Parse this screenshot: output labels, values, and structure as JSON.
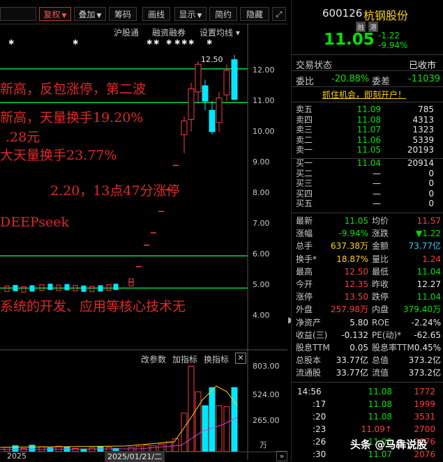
{
  "toolbar": {
    "buttons": [
      "复权",
      "叠加",
      "筹码",
      "画线",
      "显示",
      "简约",
      "隐藏"
    ],
    "expand_icon": "expand-icon"
  },
  "chart_links": {
    "hugutong": "沪股通",
    "margin": "融资融券",
    "ma_settings": "设置均线"
  },
  "y_axis": [
    "12.00",
    "11.00",
    "10.00",
    "9.00",
    "8.00",
    "7.00",
    "6.00",
    "5.00",
    "4.00"
  ],
  "high_label": "12.50",
  "annotations": [
    "新高，反包涨停，第二波",
    "新高，天量换手19.20%",
    ".28元",
    "大天量换手23.77%",
    "2.20，13点47分涨停",
    "DEEPseek",
    "系统的开发、应用等核心技术无"
  ],
  "indicator_bar": {
    "params": "改参数",
    "add": "加指标",
    "switch": "换指标",
    "close_icon": "close-icon"
  },
  "volume_axis": [
    "803.00",
    "524.00",
    "265.00",
    "万"
  ],
  "bottom_bar": {
    "year": "2025",
    "date": "2025/01/21/二"
  },
  "stock": {
    "code": "600126",
    "name": "杭钢股份",
    "badges": [
      "融",
      "港"
    ],
    "price": "11.05",
    "change": "-1.22",
    "change_pct": "-9.94%",
    "status_label": "交易状态",
    "status_value": "已收市",
    "weibi_label": "委比",
    "weibi_value": "-20.88%",
    "weicha_label": "委差",
    "weicha_value": "-11039",
    "promo": "抓住机会，即刻开户！"
  },
  "orderbook": {
    "sells": [
      {
        "label": "卖五",
        "price": "11.09",
        "vol": "785"
      },
      {
        "label": "卖四",
        "price": "11.08",
        "vol": "4313"
      },
      {
        "label": "卖三",
        "price": "11.07",
        "vol": "1323"
      },
      {
        "label": "卖二",
        "price": "11.06",
        "vol": "5339"
      },
      {
        "label": "卖一",
        "price": "11.05",
        "vol": "20193"
      }
    ],
    "buys": [
      {
        "label": "买一",
        "price": "11.04",
        "vol": "20914"
      },
      {
        "label": "买二",
        "price": "—",
        "vol": "0"
      },
      {
        "label": "买三",
        "price": "—",
        "vol": "0"
      },
      {
        "label": "买四",
        "price": "—",
        "vol": "0"
      },
      {
        "label": "买五",
        "price": "—",
        "vol": "0"
      }
    ]
  },
  "quote": [
    {
      "l1": "最新",
      "v1": "11.05",
      "c1": "green",
      "l2": "均价",
      "v2": "11.57",
      "c2": "red"
    },
    {
      "l1": "涨幅",
      "v1": "-9.94%",
      "c1": "green",
      "l2": "涨跌",
      "v2": "▼1.22",
      "c2": "green"
    },
    {
      "l1": "总手",
      "v1": "637.38万",
      "c1": "yellow",
      "l2": "金额",
      "v2": "73.77亿",
      "c2": "cyan"
    },
    {
      "l1": "换手*",
      "v1": "18.87%",
      "c1": "yellow",
      "l2": "量比",
      "v2": "1.24",
      "c2": "red"
    },
    {
      "l1": "最高",
      "v1": "12.50",
      "c1": "red",
      "l2": "最低",
      "v2": "11.04",
      "c2": "green"
    },
    {
      "l1": "今开",
      "v1": "12.35",
      "c1": "red",
      "l2": "昨收",
      "v2": "12.27",
      "c2": "white"
    },
    {
      "l1": "涨停",
      "v1": "13.50",
      "c1": "red",
      "l2": "跌停",
      "v2": "11.04",
      "c2": "green"
    },
    {
      "l1": "外盘",
      "v1": "257.98万",
      "c1": "red",
      "l2": "内盘",
      "v2": "379.40万",
      "c2": "green"
    },
    {
      "l1": "净资产",
      "v1": "5.80",
      "c1": "white",
      "l2": "ROE",
      "v2": "-2.24%",
      "c2": "white"
    },
    {
      "l1": "收益(三)",
      "v1": "-0.132",
      "c1": "white",
      "l2": "PE(动)*",
      "v2": "-62.65",
      "c2": "white"
    },
    {
      "l1": "股息TTM",
      "v1": "0.05",
      "c1": "white",
      "l2": "股息率TTM",
      "v2": "0.45%",
      "c2": "white"
    },
    {
      "l1": "总股本",
      "v1": "33.77亿",
      "c1": "white",
      "l2": "总值",
      "v2": "373.2亿",
      "c2": "white"
    },
    {
      "l1": "流通股",
      "v1": "33.77亿",
      "c1": "white",
      "l2": "流值",
      "v2": "373.2亿",
      "c2": "white"
    }
  ],
  "ticks": [
    {
      "time": "14:56",
      "price": "11.08",
      "vol": "1772"
    },
    {
      "time": ":17",
      "price": "11.08",
      "vol": "1999"
    },
    {
      "time": ":20",
      "price": "11.08",
      "vol": "3531"
    },
    {
      "time": ":23",
      "price": "11.09↑",
      "vol": "2700"
    },
    {
      "time": ":26",
      "price": "11.08",
      "vol": "2076"
    },
    {
      "time": ":30",
      "price": "11.07",
      "vol": "2076"
    }
  ],
  "watermark": "头条 @马犇说股",
  "colors": {
    "up": "#ff3c3c",
    "down": "#00e400",
    "ma": "#00cc44",
    "vol_up": "#ff3c3c",
    "vol_down": "#00e8ff"
  }
}
